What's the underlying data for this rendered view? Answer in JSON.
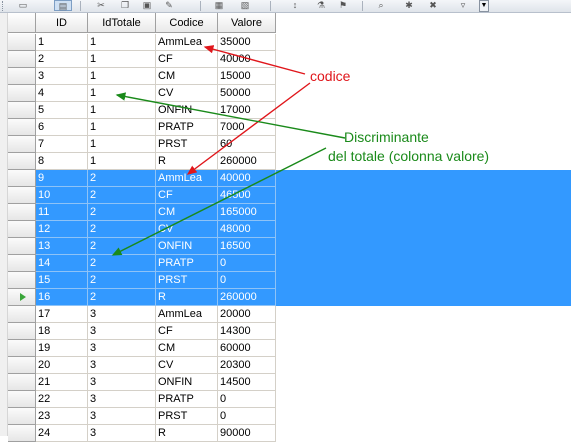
{
  "grid": {
    "columns": [
      "ID",
      "IdTotale",
      "Codice",
      "Valore"
    ],
    "rows": [
      {
        "id": "1",
        "idtotale": "1",
        "codice": "AmmLea",
        "valore": "35000",
        "selected": false
      },
      {
        "id": "2",
        "idtotale": "1",
        "codice": "CF",
        "valore": "40000",
        "selected": false
      },
      {
        "id": "3",
        "idtotale": "1",
        "codice": "CM",
        "valore": "15000",
        "selected": false
      },
      {
        "id": "4",
        "idtotale": "1",
        "codice": "CV",
        "valore": "50000",
        "selected": false
      },
      {
        "id": "5",
        "idtotale": "1",
        "codice": "ONFIN",
        "valore": "17000",
        "selected": false
      },
      {
        "id": "6",
        "idtotale": "1",
        "codice": "PRATP",
        "valore": "7000",
        "selected": false
      },
      {
        "id": "7",
        "idtotale": "1",
        "codice": "PRST",
        "valore": "60",
        "selected": false
      },
      {
        "id": "8",
        "idtotale": "1",
        "codice": "R",
        "valore": "260000",
        "selected": false
      },
      {
        "id": "9",
        "idtotale": "2",
        "codice": "AmmLea",
        "valore": "40000",
        "selected": true
      },
      {
        "id": "10",
        "idtotale": "2",
        "codice": "CF",
        "valore": "46500",
        "selected": true
      },
      {
        "id": "11",
        "idtotale": "2",
        "codice": "CM",
        "valore": "165000",
        "selected": true
      },
      {
        "id": "12",
        "idtotale": "2",
        "codice": "CV",
        "valore": "48000",
        "selected": true
      },
      {
        "id": "13",
        "idtotale": "2",
        "codice": "ONFIN",
        "valore": "16500",
        "selected": true
      },
      {
        "id": "14",
        "idtotale": "2",
        "codice": "PRATP",
        "valore": "0",
        "selected": true
      },
      {
        "id": "15",
        "idtotale": "2",
        "codice": "PRST",
        "valore": "0",
        "selected": true
      },
      {
        "id": "16",
        "idtotale": "2",
        "codice": "R",
        "valore": "260000",
        "selected": true,
        "current": true
      },
      {
        "id": "17",
        "idtotale": "3",
        "codice": "AmmLea",
        "valore": "20000",
        "selected": false
      },
      {
        "id": "18",
        "idtotale": "3",
        "codice": "CF",
        "valore": "14300",
        "selected": false
      },
      {
        "id": "19",
        "idtotale": "3",
        "codice": "CM",
        "valore": "60000",
        "selected": false
      },
      {
        "id": "20",
        "idtotale": "3",
        "codice": "CV",
        "valore": "20300",
        "selected": false
      },
      {
        "id": "21",
        "idtotale": "3",
        "codice": "ONFIN",
        "valore": "14500",
        "selected": false
      },
      {
        "id": "22",
        "idtotale": "3",
        "codice": "PRATP",
        "valore": "0",
        "selected": false
      },
      {
        "id": "23",
        "idtotale": "3",
        "codice": "PRST",
        "valore": "0",
        "selected": false
      },
      {
        "id": "24",
        "idtotale": "3",
        "codice": "R",
        "valore": "90000",
        "selected": false
      }
    ]
  },
  "annotations": {
    "codice": "codice",
    "discriminante_line1": "Discriminante",
    "discriminante_line2": "del totale (colonna valore)"
  },
  "colors": {
    "selection": "#3399ff",
    "annotation_red": "#e0161b",
    "annotation_green": "#1a8a1a",
    "current_row_pointer": "#3aa63a"
  },
  "toolbar": {
    "icons": [
      "print-icon",
      "print-preview-icon",
      "cut-icon",
      "copy-icon",
      "paste-icon",
      "format-painter-icon",
      "table-icon",
      "properties-icon",
      "sort-ascending-icon",
      "filter-icon",
      "filter-selection-icon",
      "find-icon",
      "new-record-icon",
      "delete-record-icon",
      "dropdown-icon"
    ]
  }
}
